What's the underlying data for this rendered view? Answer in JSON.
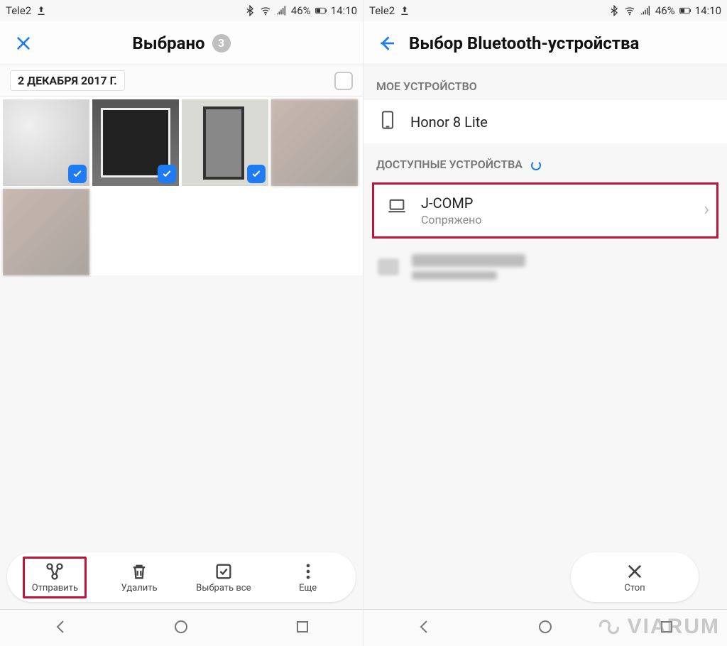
{
  "status": {
    "carrier": "Tele2",
    "battery_pct": "46%",
    "time": "14:10"
  },
  "left": {
    "title": "Выбрано",
    "selected_count": "3",
    "date_label": "2 ДЕКАБРЯ 2017 Г.",
    "actions": {
      "send": "Отправить",
      "delete": "Удалить",
      "select_all": "Выбрать все",
      "more": "Еще"
    }
  },
  "right": {
    "title": "Выбор Bluetooth-устройства",
    "section_my": "МОЕ УСТРОЙСТВО",
    "my_device": "Honor 8 Lite",
    "section_avail": "ДОСТУПНЫЕ УСТРОЙСТВА",
    "paired_name": "J-COMP",
    "paired_status": "Сопряжено",
    "action_stop": "Стоп"
  },
  "watermark": "VIARUM"
}
